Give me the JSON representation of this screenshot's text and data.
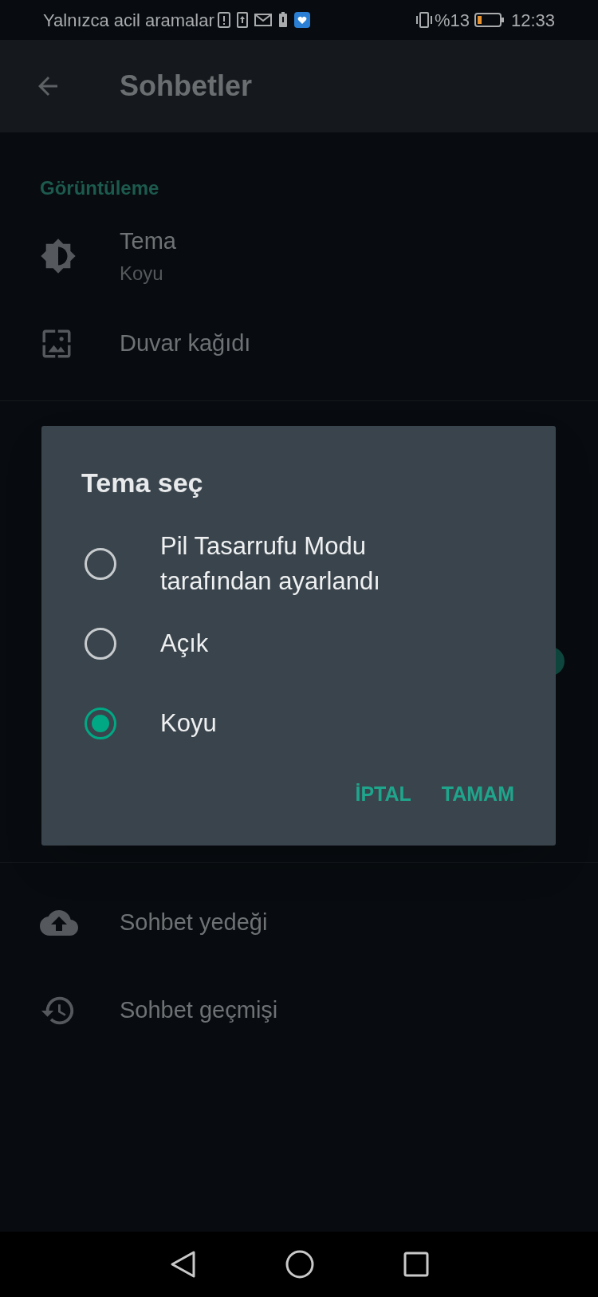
{
  "status_bar": {
    "carrier": "Yalnızca acil aramalar",
    "battery_text": "%13",
    "time": "12:33"
  },
  "app_bar": {
    "title": "Sohbetler"
  },
  "section": {
    "title": "Görüntüleme"
  },
  "items": [
    {
      "kind": "theme",
      "title": "Tema",
      "subtitle": "Koyu"
    },
    {
      "kind": "wallpaper",
      "title": "Duvar kağıdı"
    }
  ],
  "background_switch": {
    "on": true
  },
  "bottom_items": [
    {
      "kind": "backup",
      "title": "Sohbet yedeği"
    },
    {
      "kind": "history",
      "title": "Sohbet geçmişi"
    }
  ],
  "dialog": {
    "title": "Tema seç",
    "options": [
      {
        "label": "Pil Tasarrufu Modu tarafından ayarlandı",
        "selected": false
      },
      {
        "label": "Açık",
        "selected": false
      },
      {
        "label": "Koyu",
        "selected": true
      }
    ],
    "buttons": [
      "İPTAL",
      "TAMAM"
    ]
  }
}
